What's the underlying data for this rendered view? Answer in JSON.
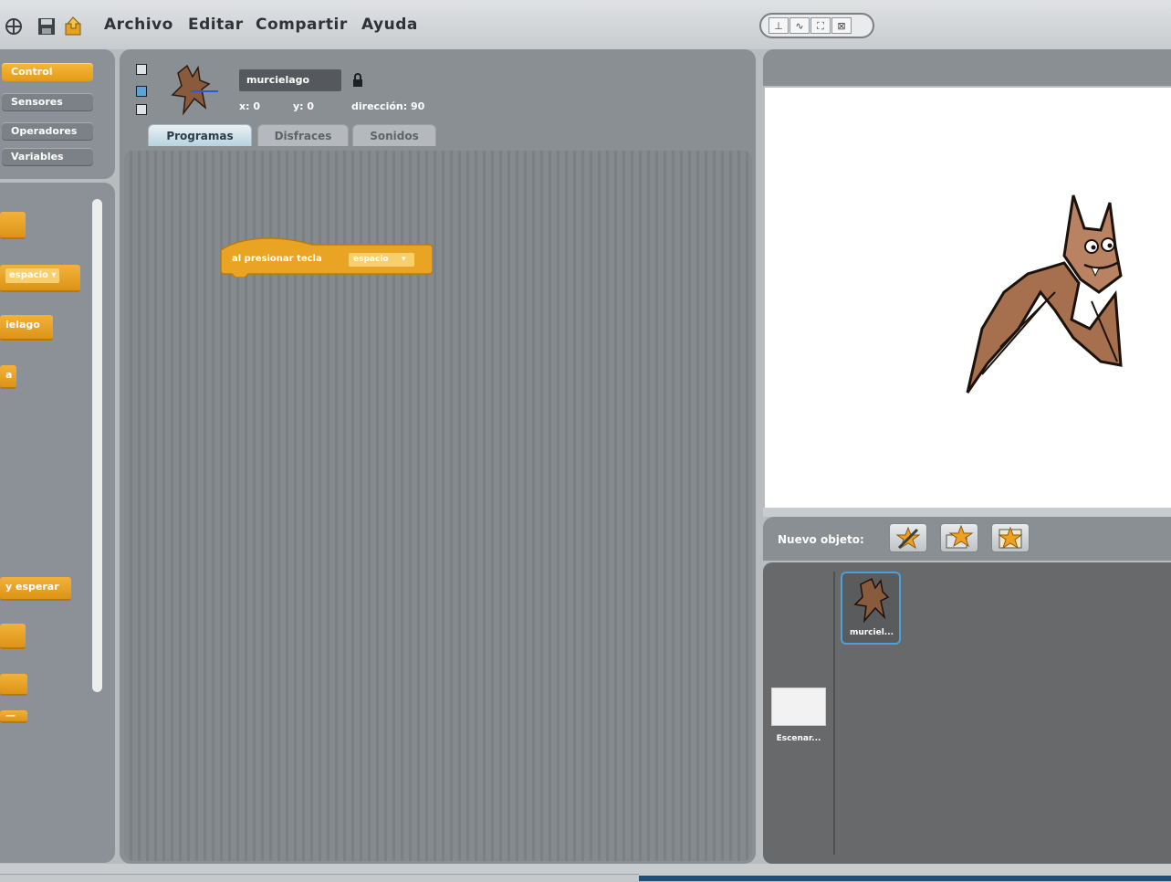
{
  "menu": {
    "items": [
      "Archivo",
      "Editar",
      "Compartir",
      "Ayuda"
    ]
  },
  "toolbar_icons": [
    "globe-icon",
    "save-icon",
    "share-icon"
  ],
  "stage_modes": [
    "⊥",
    "∿",
    "⛶",
    "⊠"
  ],
  "categories": {
    "items": [
      {
        "label": "Control",
        "active": true
      },
      {
        "label": "Sensores",
        "active": false
      },
      {
        "label": "Operadores",
        "active": false
      },
      {
        "label": "Variables",
        "active": false
      }
    ]
  },
  "palette": {
    "blocks": [
      "",
      "espacio ▾",
      "ielago",
      "a",
      "y esperar",
      "",
      "",
      "—"
    ]
  },
  "sprite": {
    "name": "murcielago",
    "x_label": "x: 0",
    "y_label": "y: 0",
    "direction_label": "dirección: 90"
  },
  "tabs": [
    {
      "label": "Programas",
      "active": true
    },
    {
      "label": "Disfraces",
      "active": false
    },
    {
      "label": "Sonidos",
      "active": false
    }
  ],
  "script": {
    "hat_text": "al presionar tecla",
    "key_value": "espacio"
  },
  "sprite_list": {
    "new_sprite_label": "Nuevo objeto:",
    "sprite_thumb_label": "murciel...",
    "stage_thumb_label": "Escenar..."
  },
  "colors": {
    "control": "#e6a124",
    "panel": "#8a8f94",
    "selected": "#4da0d8"
  }
}
